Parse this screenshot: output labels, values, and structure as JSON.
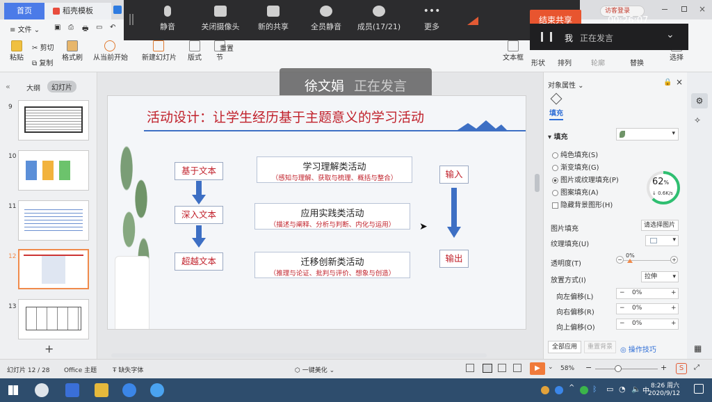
{
  "tabs": [
    {
      "label": "首页"
    },
    {
      "label": "稻壳模板"
    }
  ],
  "ribbon": {
    "file": "文件",
    "paste": "粘贴",
    "cut": "剪切",
    "copy": "复制",
    "format_painter": "格式刷",
    "from_current": "从当前开始",
    "new_slide": "新建幻灯片",
    "layout": "版式",
    "section": "节",
    "reset": "重置",
    "textbox": "文本框",
    "shape": "形状",
    "arrange": "排列",
    "outline": "轮廓",
    "replace": "替换",
    "select": "选择"
  },
  "meeting": {
    "mute": "静音",
    "camera_off": "关闭摄像头",
    "new_share": "新的共享",
    "mute_all": "全员静音",
    "members": "成员(17/21)",
    "more": "更多",
    "timer": "00:26:07",
    "end_share": "结束共享",
    "me": "我",
    "speaking": "正在发言"
  },
  "overlay": {
    "name": "徐文娟",
    "status": "正在发言"
  },
  "guest_login": "访客登录",
  "left_panel": {
    "tab_outline": "大纲",
    "tab_slides": "幻灯片",
    "slides": [
      {
        "num": "9"
      },
      {
        "num": "10"
      },
      {
        "num": "11"
      },
      {
        "num": "12"
      },
      {
        "num": "13"
      }
    ],
    "add": "+"
  },
  "slide": {
    "title": "活动设计：让学生经历基于主题意义的学习活动",
    "levels": [
      "基于文本",
      "深入文本",
      "超越文本"
    ],
    "activities": [
      {
        "name": "学习理解类活动",
        "detail": "（感知与理解、获取与梳理、概括与整合）"
      },
      {
        "name": "应用实践类活动",
        "detail": "（描述与阐释、分析与判断、内化与运用）"
      },
      {
        "name": "迁移创新类活动",
        "detail": "（推理与论证、批判与评价、想象与创造）"
      }
    ],
    "input": "输入",
    "output": "输出"
  },
  "right_panel": {
    "title": "对象属性",
    "tab": "填充",
    "section": "填充",
    "options": [
      {
        "label": "纯色填充(S)",
        "on": false
      },
      {
        "label": "渐变填充(G)",
        "on": false
      },
      {
        "label": "图片或纹理填充(P)",
        "on": true
      },
      {
        "label": "图案填充(A)",
        "on": false
      }
    ],
    "hide_bg": "隐藏背景图形(H)",
    "picture_fill": "图片填充",
    "picture_choose": "请选择图片",
    "texture_fill": "纹理填充(U)",
    "transparency": "透明度(T)",
    "transparency_val": "0%",
    "placement": "放置方式(I)",
    "placement_val": "拉伸",
    "offsets": [
      {
        "label": "向左偏移(L)",
        "val": "0%"
      },
      {
        "label": "向右偏移(R)",
        "val": "0%"
      },
      {
        "label": "向上偏移(O)",
        "val": "0%"
      }
    ],
    "apply_all": "全部应用",
    "reset_bg": "重置背景",
    "tips": "操作技巧",
    "gauge_pct": "62",
    "gauge_unit": "%",
    "gauge_speed": "0.6K/s"
  },
  "status": {
    "slide_info": "幻灯片 12 / 28",
    "theme": "Office 主题",
    "missing_font": "缺失字体",
    "beautify": "一键美化",
    "zoom": "58%"
  },
  "taskbar": {
    "time": "8:26 周六",
    "date": "2020/9/12"
  },
  "colors": {
    "accent": "#4b7be8",
    "slide_red": "#c0202a",
    "arrow_blue": "#3d6fc4",
    "end_share": "#e8552f",
    "gauge": "#2fbf71"
  }
}
